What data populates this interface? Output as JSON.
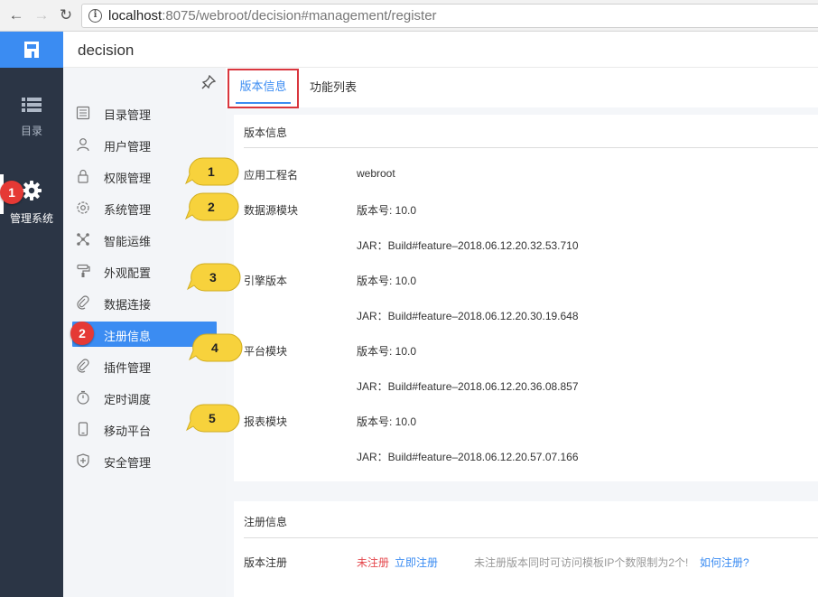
{
  "browser": {
    "url_host": "localhost",
    "url_rest": ":8075/webroot/decision#management/register"
  },
  "app": {
    "title": "decision"
  },
  "dark_sidebar": {
    "items": [
      {
        "label": "目录",
        "icon": "list-icon"
      },
      {
        "label": "管理系统",
        "icon": "gear-icon"
      }
    ]
  },
  "menu": {
    "items": [
      {
        "label": "目录管理",
        "icon": "directory-icon"
      },
      {
        "label": "用户管理",
        "icon": "user-icon"
      },
      {
        "label": "权限管理",
        "icon": "lock-icon"
      },
      {
        "label": "系统管理",
        "icon": "settings-icon"
      },
      {
        "label": "智能运维",
        "icon": "network-icon"
      },
      {
        "label": "外观配置",
        "icon": "paint-roller-icon"
      },
      {
        "label": "数据连接",
        "icon": "link-icon"
      },
      {
        "label": "注册信息",
        "icon": "register-icon"
      },
      {
        "label": "插件管理",
        "icon": "plugin-icon"
      },
      {
        "label": "定时调度",
        "icon": "timer-icon"
      },
      {
        "label": "移动平台",
        "icon": "mobile-icon"
      },
      {
        "label": "安全管理",
        "icon": "shield-icon"
      }
    ]
  },
  "tabs": [
    {
      "label": "版本信息"
    },
    {
      "label": "功能列表"
    }
  ],
  "version_card": {
    "title": "版本信息",
    "rows": [
      {
        "label": "应用工程名",
        "value": "webroot"
      },
      {
        "label": "数据源模块",
        "value": "版本号: 10.0"
      },
      {
        "label": "",
        "value": "JAR：Build#feature–2018.06.12.20.32.53.710"
      },
      {
        "label": "引擎版本",
        "value": "版本号: 10.0"
      },
      {
        "label": "",
        "value": "JAR：Build#feature–2018.06.12.20.30.19.648"
      },
      {
        "label": "平台模块",
        "value": "版本号: 10.0"
      },
      {
        "label": "",
        "value": "JAR：Build#feature–2018.06.12.20.36.08.857"
      },
      {
        "label": "报表模块",
        "value": "版本号: 10.0"
      },
      {
        "label": "",
        "value": "JAR：Build#feature–2018.06.12.20.57.07.166"
      }
    ]
  },
  "reg_card": {
    "title": "注册信息",
    "label": "版本注册",
    "status": "未注册",
    "register_now": "立即注册",
    "note": "未注册版本同时可访问模板IP个数限制为2个!",
    "how_link": "如何注册?"
  },
  "annotations": {
    "red": [
      "1",
      "2"
    ],
    "yellow": [
      "1",
      "2",
      "3",
      "4",
      "5"
    ],
    "red_color": "#e53935",
    "yellow_color": "#f7d23c"
  }
}
